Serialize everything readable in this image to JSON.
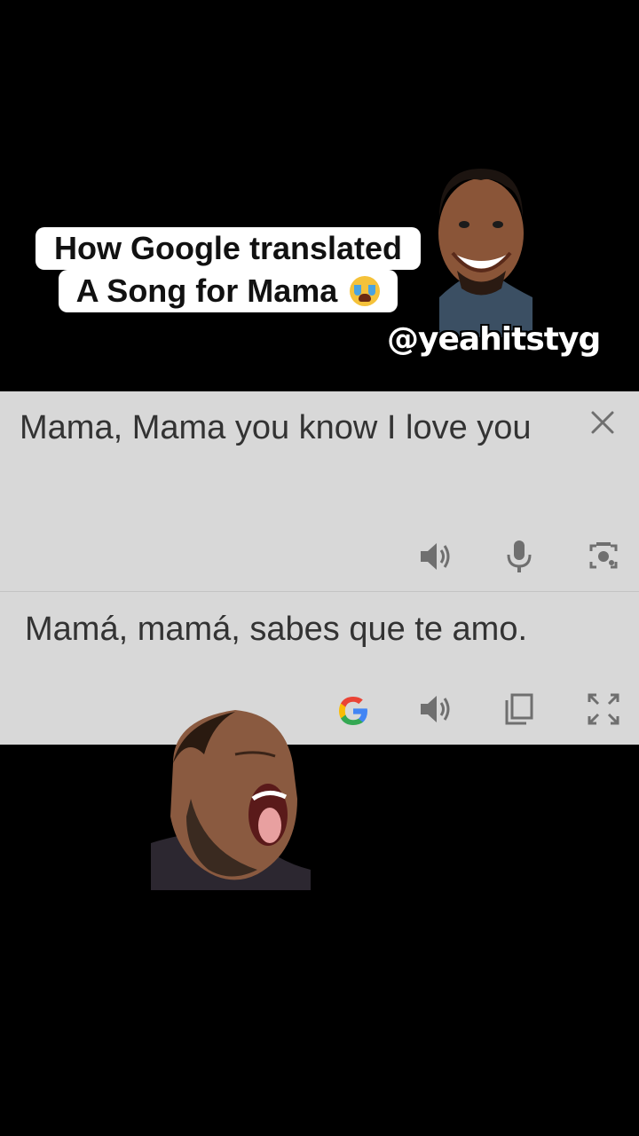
{
  "caption": {
    "line1": "How Google translated",
    "line2": "A Song for Mama",
    "emoji": "loudly-crying-face"
  },
  "handle": "@yeahitstyg",
  "translate": {
    "source_text": "Mama, Mama you know I love you",
    "result_text": "Mamá, mamá, sabes que te amo.",
    "icons_source": [
      "close-icon",
      "speaker-icon",
      "mic-icon",
      "camera-lens-icon"
    ],
    "icons_result": [
      "google-icon",
      "speaker-icon",
      "copy-icon",
      "fullscreen-icon"
    ]
  },
  "colors": {
    "background": "#000000",
    "panel": "#d8d8d8",
    "icon": "#6f6f6f",
    "text": "#333333"
  }
}
